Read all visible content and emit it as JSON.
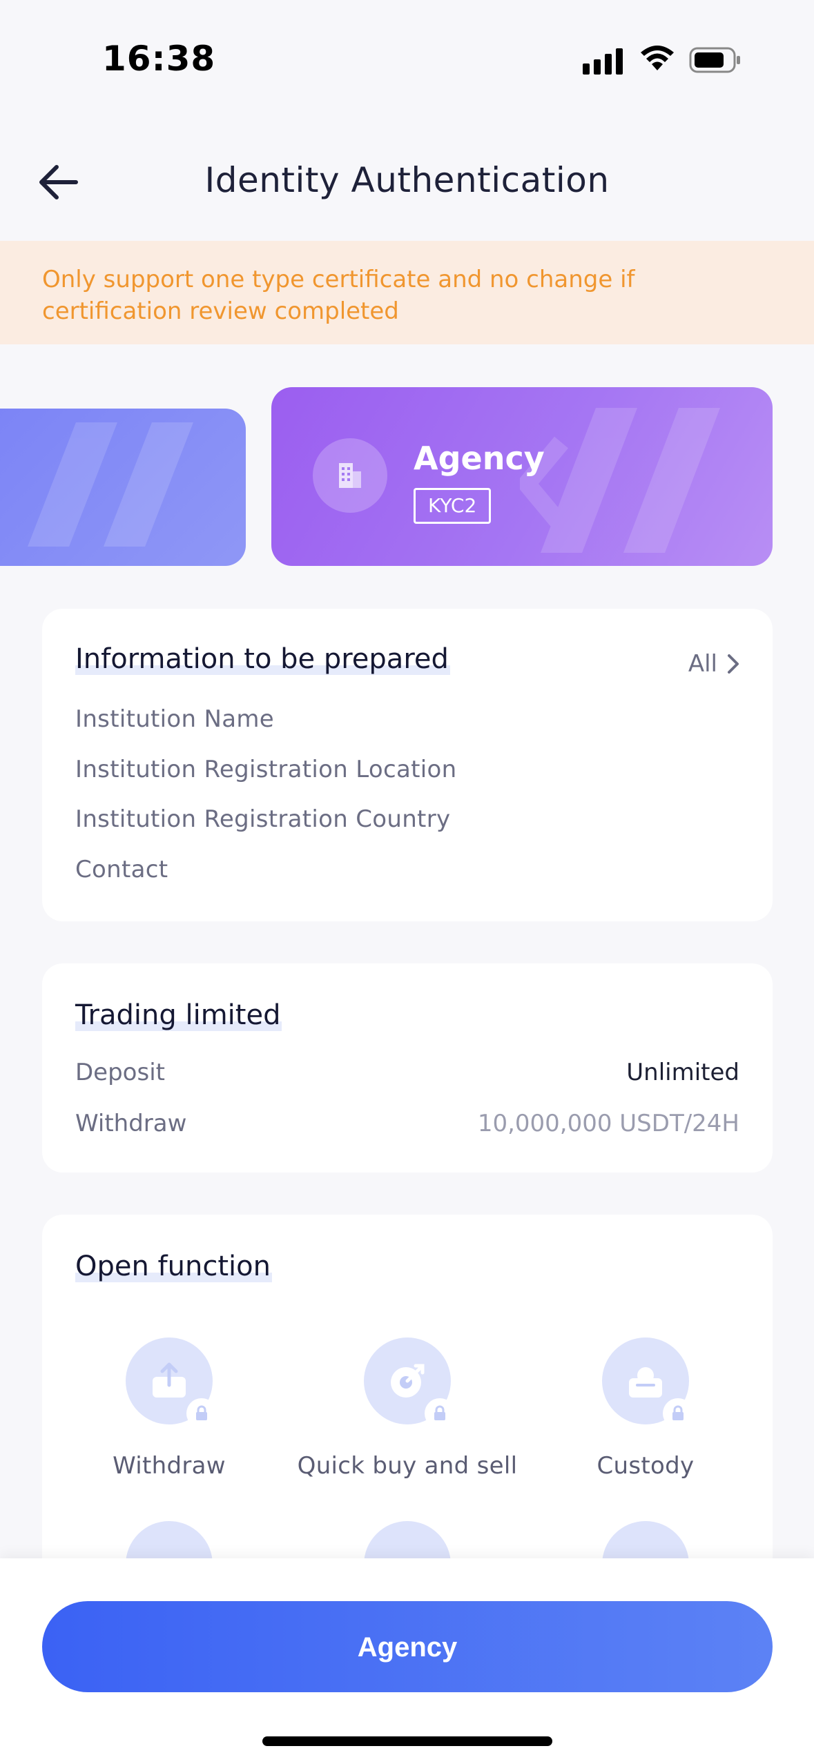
{
  "status_bar": {
    "time": "16:38"
  },
  "header": {
    "title": "Identity Authentication"
  },
  "notice": {
    "text": "Only support one type certificate and no change if certification review completed"
  },
  "cards": {
    "active": {
      "title": "Agency",
      "badge": "KYC2"
    }
  },
  "prepare": {
    "title": "Information to be prepared",
    "all_label": "All",
    "items": [
      "Institution Name",
      "Institution Registration Location",
      "Institution Registration Country",
      "Contact"
    ]
  },
  "trading": {
    "title": "Trading limited",
    "rows": [
      {
        "label": "Deposit",
        "value": "Unlimited"
      },
      {
        "label": "Withdraw",
        "value": "10,000,000 USDT/24H"
      }
    ]
  },
  "functions": {
    "title": "Open function",
    "items": [
      {
        "label": "Withdraw",
        "icon": "upload-tray-icon"
      },
      {
        "label": "Quick buy and sell",
        "icon": "target-arrow-icon"
      },
      {
        "label": "Custody",
        "icon": "vault-icon"
      }
    ]
  },
  "footer": {
    "button_label": "Agency"
  },
  "colors": {
    "accent": "#3b62f4",
    "card_purple": "#9b5ef0",
    "notice_text": "#f0962f",
    "notice_bg": "#fbece1"
  }
}
